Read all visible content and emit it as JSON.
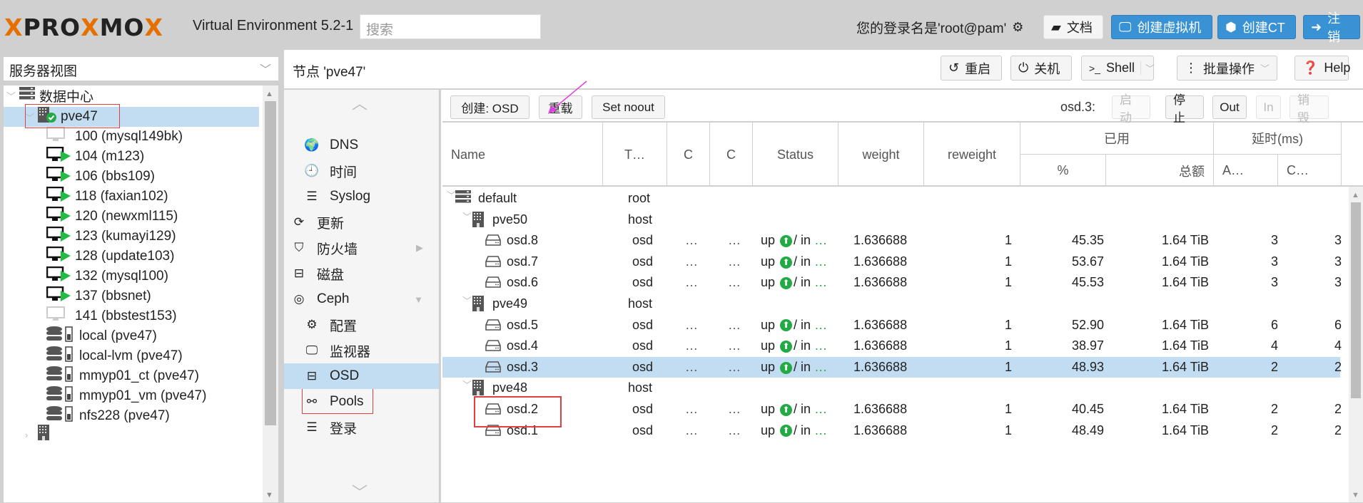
{
  "header": {
    "logo_a": "PRO",
    "logo_x": "X",
    "logo_b": "MO",
    "version": "Virtual Environment 5.2-1",
    "search_placeholder": "搜索",
    "login_text": "您的登录名是'root@pam'",
    "docs": "文档",
    "create_vm": "创建虚拟机",
    "create_ct": "创建CT",
    "logout": "注销"
  },
  "sidebar": {
    "view": "服务器视图",
    "tree": [
      {
        "label": "数据中心",
        "icon": "datacenter-icon",
        "level": 0
      },
      {
        "label": "pve47",
        "icon": "node-online-icon",
        "level": 1,
        "selected": true
      },
      {
        "label": "100 (mysql149bk)",
        "icon": "vm-stopped-icon",
        "level": 2
      },
      {
        "label": "104 (m123)",
        "icon": "vm-running-icon",
        "level": 2
      },
      {
        "label": "106 (bbs109)",
        "icon": "vm-running-icon",
        "level": 2
      },
      {
        "label": "118 (faxian102)",
        "icon": "vm-running-icon",
        "level": 2
      },
      {
        "label": "120 (newxml115)",
        "icon": "vm-running-icon",
        "level": 2
      },
      {
        "label": "123 (kumayi129)",
        "icon": "vm-running-icon",
        "level": 2
      },
      {
        "label": "128 (update103)",
        "icon": "vm-running-icon",
        "level": 2
      },
      {
        "label": "132 (mysql100)",
        "icon": "vm-running-icon",
        "level": 2
      },
      {
        "label": "137 (bbsnet)",
        "icon": "vm-running-icon",
        "level": 2
      },
      {
        "label": "141 (bbstest153)",
        "icon": "vm-stopped-icon",
        "level": 2
      },
      {
        "label": "local (pve47)",
        "icon": "storage-icon",
        "level": 2
      },
      {
        "label": "local-lvm (pve47)",
        "icon": "storage-icon",
        "level": 2
      },
      {
        "label": "mmyp01_ct (pve47)",
        "icon": "storage-icon",
        "level": 2
      },
      {
        "label": "mmyp01_vm (pve47)",
        "icon": "storage-icon",
        "level": 2
      },
      {
        "label": "nfs228 (pve47)",
        "icon": "storage-icon",
        "level": 2
      }
    ]
  },
  "node": {
    "title": "节点 'pve47'",
    "restart": "重启",
    "shutdown": "关机",
    "shell": "Shell",
    "bulk": "批量操作",
    "help": "Help"
  },
  "nav": [
    {
      "label": "DNS",
      "icon": "globe-icon",
      "indent": true
    },
    {
      "label": "时间",
      "icon": "clock-icon",
      "indent": true
    },
    {
      "label": "Syslog",
      "icon": "list-icon",
      "indent": true
    },
    {
      "label": "更新",
      "icon": "refresh-icon",
      "indent": false
    },
    {
      "label": "防火墙",
      "icon": "shield-icon",
      "indent": false,
      "arrow": "▶"
    },
    {
      "label": "磁盘",
      "icon": "disk-icon",
      "indent": false
    },
    {
      "label": "Ceph",
      "icon": "ceph-icon",
      "indent": false,
      "arrow": "▼"
    },
    {
      "label": "配置",
      "icon": "gear-icon",
      "indent": true
    },
    {
      "label": "监视器",
      "icon": "monitor-icon",
      "indent": true
    },
    {
      "label": "OSD",
      "icon": "disk-icon",
      "indent": true,
      "selected": true
    },
    {
      "label": "Pools",
      "icon": "sitemap-icon",
      "indent": true
    },
    {
      "label": "登录",
      "icon": "list-icon",
      "indent": true
    }
  ],
  "toolbar": {
    "create_osd": "创建: OSD",
    "reload": "重载",
    "set_noout": "Set noout",
    "osd_label": "osd.3:",
    "start": "启动",
    "stop": "停止",
    "out": "Out",
    "in": "In",
    "destroy": "销毁"
  },
  "columns": {
    "name": "Name",
    "type": "T…",
    "c1": "C",
    "c2": "C",
    "status": "Status",
    "weight": "weight",
    "reweight": "reweight",
    "used_group": "已用",
    "used_pct": "%",
    "used_total": "总额",
    "latency_group": "延时(ms)",
    "lat_a": "A…",
    "lat_c": "C…"
  },
  "rows": [
    {
      "name": "default",
      "type": "root",
      "kind": "root"
    },
    {
      "name": "pve50",
      "type": "host",
      "kind": "host"
    },
    {
      "name": "osd.8",
      "type": "osd",
      "kind": "osd",
      "c1": "…",
      "c2": "…",
      "status_up": "up",
      "status_in": "/ in",
      "weight": "1.636688",
      "reweight": "1",
      "pct": "45.35",
      "total": "1.64 TiB",
      "lat_a": "3",
      "lat_c": "3"
    },
    {
      "name": "osd.7",
      "type": "osd",
      "kind": "osd",
      "c1": "…",
      "c2": "…",
      "status_up": "up",
      "status_in": "/ in",
      "weight": "1.636688",
      "reweight": "1",
      "pct": "53.67",
      "total": "1.64 TiB",
      "lat_a": "3",
      "lat_c": "3"
    },
    {
      "name": "osd.6",
      "type": "osd",
      "kind": "osd",
      "c1": "…",
      "c2": "…",
      "status_up": "up",
      "status_in": "/ in",
      "weight": "1.636688",
      "reweight": "1",
      "pct": "45.53",
      "total": "1.64 TiB",
      "lat_a": "3",
      "lat_c": "3"
    },
    {
      "name": "pve49",
      "type": "host",
      "kind": "host"
    },
    {
      "name": "osd.5",
      "type": "osd",
      "kind": "osd",
      "c1": "…",
      "c2": "…",
      "status_up": "up",
      "status_in": "/ in",
      "weight": "1.636688",
      "reweight": "1",
      "pct": "52.90",
      "total": "1.64 TiB",
      "lat_a": "6",
      "lat_c": "6"
    },
    {
      "name": "osd.4",
      "type": "osd",
      "kind": "osd",
      "c1": "…",
      "c2": "…",
      "status_up": "up",
      "status_in": "/ in",
      "weight": "1.636688",
      "reweight": "1",
      "pct": "38.97",
      "total": "1.64 TiB",
      "lat_a": "4",
      "lat_c": "4"
    },
    {
      "name": "osd.3",
      "type": "osd",
      "kind": "osd",
      "c1": "…",
      "c2": "…",
      "status_up": "up",
      "status_in": "/ in",
      "weight": "1.636688",
      "reweight": "1",
      "pct": "48.93",
      "total": "1.64 TiB",
      "lat_a": "2",
      "lat_c": "2",
      "selected": true
    },
    {
      "name": "pve48",
      "type": "host",
      "kind": "host"
    },
    {
      "name": "osd.2",
      "type": "osd",
      "kind": "osd",
      "c1": "…",
      "c2": "…",
      "status_up": "up",
      "status_in": "/ in",
      "weight": "1.636688",
      "reweight": "1",
      "pct": "40.45",
      "total": "1.64 TiB",
      "lat_a": "2",
      "lat_c": "2"
    },
    {
      "name": "osd.1",
      "type": "osd",
      "kind": "osd",
      "c1": "…",
      "c2": "…",
      "status_up": "up",
      "status_in": "/ in",
      "weight": "1.636688",
      "reweight": "1",
      "pct": "48.49",
      "total": "1.64 TiB",
      "lat_a": "2",
      "lat_c": "2"
    }
  ],
  "colors": {
    "accent_blue": "#3892d4",
    "selection": "#c2ddf2",
    "status_green": "#22aa44",
    "logo_orange": "#e57000",
    "annotation_red": "#e04040",
    "annotation_magenta": "#e040e0"
  }
}
